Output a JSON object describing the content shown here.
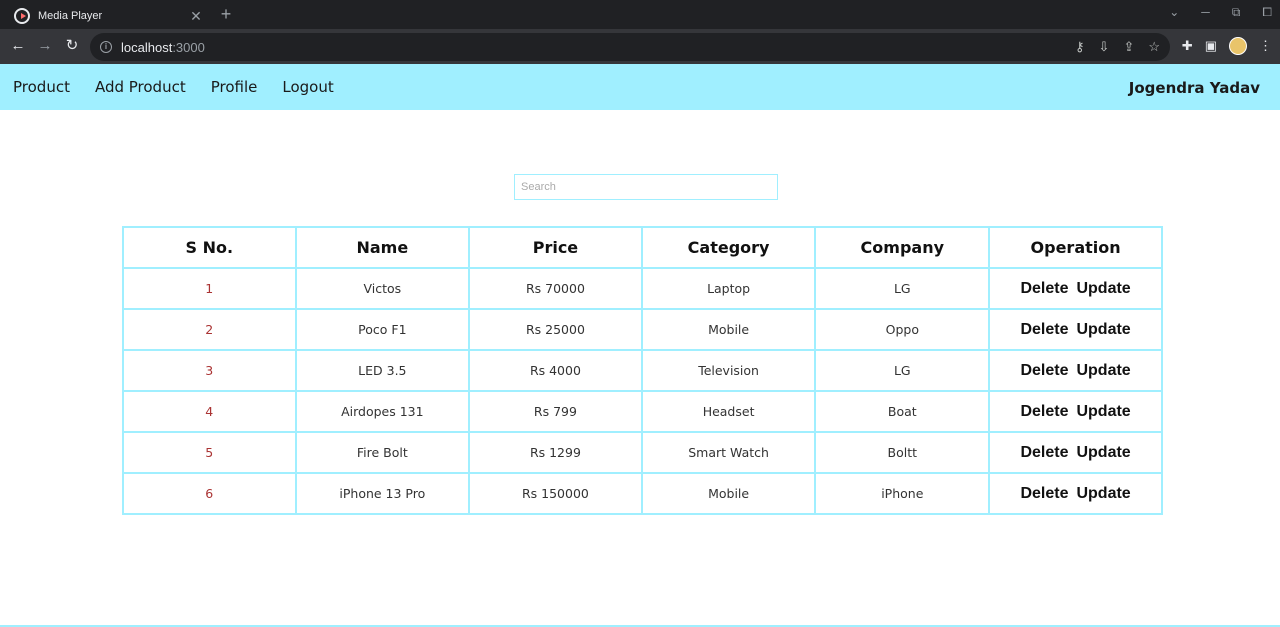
{
  "browser": {
    "tab_title": "Media Player",
    "url_host": "localhost",
    "url_port": ":3000",
    "new_tab_symbol": "+",
    "close_symbol": "✕"
  },
  "nav": {
    "links": [
      "Product",
      "Add Product",
      "Profile",
      "Logout"
    ],
    "user": "Jogendra Yadav"
  },
  "search": {
    "placeholder": "Search"
  },
  "table": {
    "headers": [
      "S No.",
      "Name",
      "Price",
      "Category",
      "Company",
      "Operation"
    ],
    "rows": [
      {
        "sno": "1",
        "name": "Victos",
        "price": "Rs 70000",
        "category": "Laptop",
        "company": "LG"
      },
      {
        "sno": "2",
        "name": "Poco F1",
        "price": "Rs 25000",
        "category": "Mobile",
        "company": "Oppo"
      },
      {
        "sno": "3",
        "name": "LED 3.5",
        "price": "Rs 4000",
        "category": "Television",
        "company": "LG"
      },
      {
        "sno": "4",
        "name": "Airdopes 131",
        "price": "Rs 799",
        "category": "Headset",
        "company": "Boat"
      },
      {
        "sno": "5",
        "name": "Fire Bolt",
        "price": "Rs 1299",
        "category": "Smart Watch",
        "company": "Boltt"
      },
      {
        "sno": "6",
        "name": "iPhone 13 Pro",
        "price": "Rs 150000",
        "category": "Mobile",
        "company": "iPhone"
      }
    ],
    "delete_label": "Delete",
    "update_label": "Update"
  },
  "colors": {
    "accent": "#a0efff",
    "chrome_dark": "#202124",
    "chrome_toolbar": "#35363a"
  }
}
